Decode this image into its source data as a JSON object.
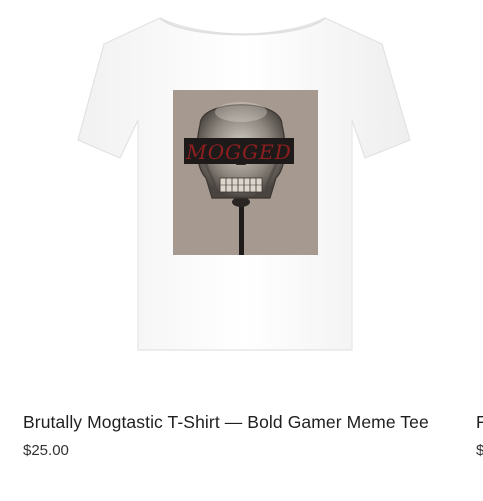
{
  "products": [
    {
      "title": "Brutally Mogtastic T-Shirt — Bold Gamer Meme Tee",
      "price": "$25.00",
      "print_text": "MOGGED",
      "colors": {
        "shirt": "#ffffff",
        "print_bg": "#9c8f84",
        "banner": "#1e1a1a",
        "banner_text": "#8e1f1f"
      }
    },
    {
      "title_partial": "F",
      "price_partial": "$"
    }
  ]
}
